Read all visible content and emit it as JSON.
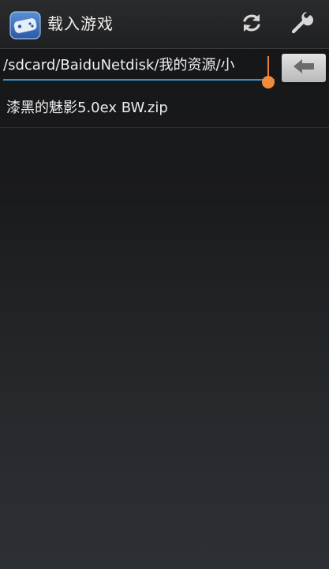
{
  "action_bar": {
    "title": "载入游戏",
    "app_icon": "gamepad-icon",
    "refresh_icon": "refresh-icon",
    "settings_icon": "wrench-icon"
  },
  "path_bar": {
    "value": "/sdcard/BaiduNetdisk/我的资源/小",
    "back_icon": "back-arrow-icon"
  },
  "files": [
    {
      "name": "漆黑的魅影5.0ex BW.zip"
    }
  ],
  "colors": {
    "accent": "#3d8fc4",
    "cursor": "#f08c3a",
    "background": "#1a1b1d"
  }
}
